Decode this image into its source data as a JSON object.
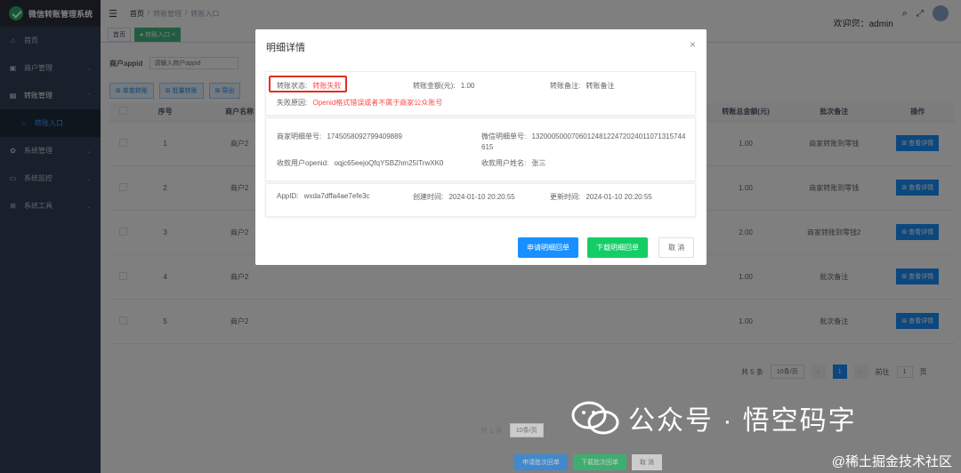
{
  "app": {
    "title": "微信转账管理系统"
  },
  "sidebar": {
    "items": [
      {
        "label": "首页",
        "icon": "home-icon",
        "glyph": "⌂"
      },
      {
        "label": "商户管理",
        "icon": "shop-icon",
        "glyph": "▣"
      },
      {
        "label": "转账管理",
        "icon": "transfer-icon",
        "glyph": "▤"
      },
      {
        "label": "转账入口",
        "icon": "entry-icon",
        "glyph": "○"
      },
      {
        "label": "系统管理",
        "icon": "gear-icon",
        "glyph": "✿"
      },
      {
        "label": "系统监控",
        "icon": "monitor-icon",
        "glyph": "▭"
      },
      {
        "label": "系统工具",
        "icon": "tool-icon",
        "glyph": "⊞"
      }
    ]
  },
  "header": {
    "breadcrumb": [
      "首页",
      "转账管理",
      "转账入口"
    ],
    "welcome": "欢迎您：admin"
  },
  "tags": [
    "首页",
    "● 转账入口 ×"
  ],
  "filter": {
    "label": "商户appid",
    "placeholder": "请输入商户appid"
  },
  "toolbar": {
    "single": "⊞ 单笔转账",
    "batch": "⊞ 批量转账",
    "export": "⊞ 导出"
  },
  "table": {
    "headers": [
      "",
      "序号",
      "商户名称",
      "",
      "",
      "",
      "",
      "",
      "转账总金额(元)",
      "批次备注",
      "操作"
    ],
    "rows": [
      {
        "no": "1",
        "merchant": "商户2",
        "amount": "1.00",
        "remark": "商家转账到零钱",
        "action": "⊞ 查看详情"
      },
      {
        "no": "2",
        "merchant": "商户2",
        "amount": "1.00",
        "remark": "商家转账到零钱",
        "action": "⊞ 查看详情"
      },
      {
        "no": "3",
        "merchant": "商户2",
        "amount": "2.00",
        "remark": "商家转账到零钱2",
        "action": "⊞ 查看详情"
      },
      {
        "no": "4",
        "merchant": "商户2",
        "amount": "1.00",
        "remark": "批次备注",
        "action": "⊞ 查看详情"
      },
      {
        "no": "5",
        "merchant": "商户2",
        "amount": "1.00",
        "remark": "批次备注",
        "action": "⊞ 查看详情"
      }
    ]
  },
  "pagination": {
    "total": "共 5 条",
    "size": "10条/页",
    "page": "1",
    "goto": "前往",
    "goto_val": "1",
    "suffix": "页"
  },
  "lower": {
    "total": "共 1 条",
    "size": "10条/页",
    "btn1": "申请批次回单",
    "btn2": "下载批次回单",
    "btn3": "取 消"
  },
  "modal": {
    "title": "明细详情",
    "close": "×",
    "status_label": "转账状态:",
    "status_value": "转账失败",
    "amount_label": "转账金额(元):",
    "amount_value": "1.00",
    "remark_label": "转账备注:",
    "remark_value": "转账备注",
    "fail_label": "失败原因:",
    "fail_value": "Openid格式错误或者不属于商家公众账号",
    "merchant_no_label": "商家明细单号:",
    "merchant_no_value": "1745058092799409889",
    "wechat_no_label": "微信明细单号:",
    "wechat_no_value": "132000500070601248122472024011071315744615",
    "openid_label": "收款用户openid:",
    "openid_value": "oqjc65eejoQfqYSBZhm25ITrwXK0",
    "username_label": "收款用户姓名:",
    "username_value": "张三",
    "appid_label": "AppID:",
    "appid_value": "wxda7dffa4ae7efe3c",
    "created_label": "创建时间:",
    "created_value": "2024-01-10 20:20:55",
    "updated_label": "更新时间:",
    "updated_value": "2024-01-10 20:20:55",
    "btn_apply": "申请明细回单",
    "btn_download": "下载明细回单",
    "btn_cancel": "取 消"
  },
  "watermark": {
    "text": "公众号 · 悟空码字",
    "site": "@稀土掘金技术社区"
  }
}
